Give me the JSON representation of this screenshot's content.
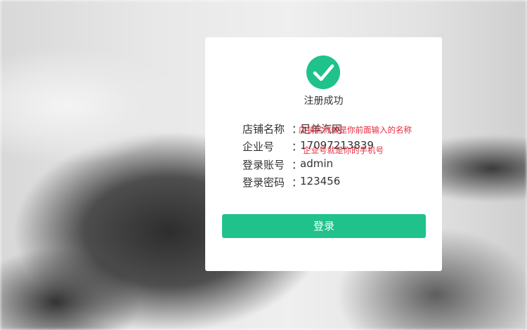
{
  "status_text": "注册成功",
  "info": [
    {
      "label": "店铺名称",
      "value": "足羊汽网"
    },
    {
      "label": "企业号",
      "value": "17097213839"
    },
    {
      "label": "登录账号",
      "value": "admin"
    },
    {
      "label": "登录密码",
      "value": "123456"
    }
  ],
  "colon": "：",
  "notes": {
    "store_name_note": "店铺名称就是你前面输入的名称",
    "company_no_note": "企业号就是你的手机号"
  },
  "login_button_label": "登录",
  "colors": {
    "accent": "#1fc28a",
    "note": "#e9283b",
    "text": "#333333"
  }
}
